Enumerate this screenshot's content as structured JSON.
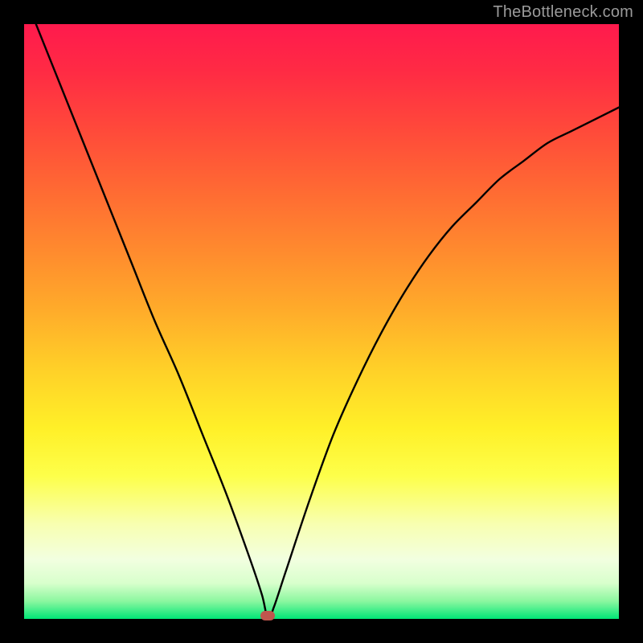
{
  "watermark": "TheBottleneck.com",
  "chart_data": {
    "type": "line",
    "title": "",
    "xlabel": "",
    "ylabel": "",
    "xlim": [
      0,
      100
    ],
    "ylim": [
      0,
      100
    ],
    "grid": false,
    "legend": false,
    "minimum_marker": {
      "x": 41,
      "y": 0
    },
    "series": [
      {
        "name": "bottleneck-curve",
        "x": [
          2,
          6,
          10,
          14,
          18,
          22,
          26,
          30,
          34,
          38,
          40,
          41,
          42,
          44,
          48,
          52,
          56,
          60,
          64,
          68,
          72,
          76,
          80,
          84,
          88,
          92,
          96,
          100
        ],
        "y": [
          100,
          90,
          80,
          70,
          60,
          50,
          41,
          31,
          21,
          10,
          4,
          0,
          2,
          8,
          20,
          31,
          40,
          48,
          55,
          61,
          66,
          70,
          74,
          77,
          80,
          82,
          84,
          86
        ]
      }
    ],
    "background_gradient": {
      "top": "#ff1a4d",
      "mid": "#ffd028",
      "bottom": "#00e676"
    }
  }
}
